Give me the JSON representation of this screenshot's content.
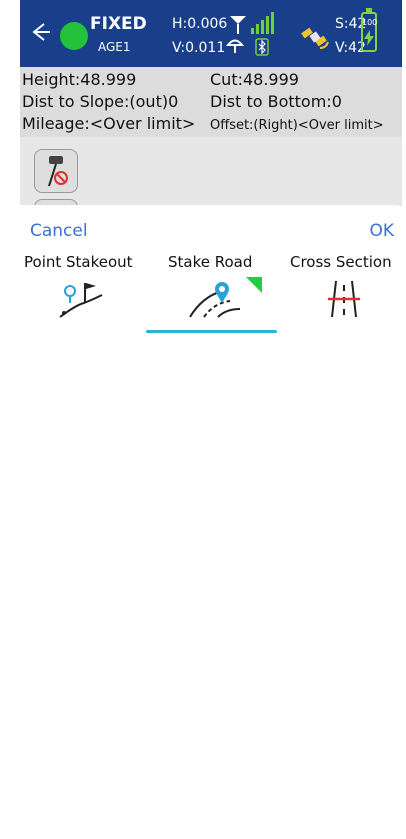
{
  "status_bar": {
    "fix_status": "FIXED",
    "age": "AGE1",
    "h_precision": "H:0.006",
    "v_precision": "V:0.011",
    "satellites_s": "S:42",
    "satellites_v": "V:42",
    "battery_text": "100",
    "fix_color": "#22c33a",
    "bar_color": "#1a3f8a"
  },
  "info": {
    "height": "Height:48.999",
    "cut": "Cut:48.999",
    "dist_slope": "Dist to Slope:(out)0",
    "dist_bottom": "Dist to Bottom:0",
    "mileage": "Mileage:<Over limit>",
    "offset": "Offset:(Right)<Over limit>"
  },
  "sheet": {
    "cancel_label": "Cancel",
    "ok_label": "OK",
    "options": [
      {
        "label": "Point Stakeout"
      },
      {
        "label": "Stake Road"
      },
      {
        "label": "Cross Section"
      }
    ],
    "selected_index": 1,
    "accent_color": "#27b5d0"
  }
}
